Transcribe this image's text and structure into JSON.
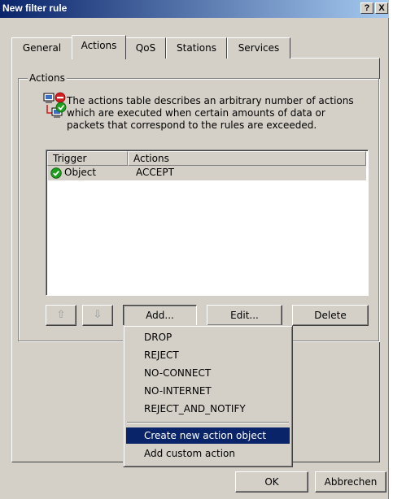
{
  "window": {
    "title": "New filter rule",
    "help_button": "?",
    "close_button": "X"
  },
  "tabs": [
    {
      "label": "General"
    },
    {
      "label": "Actions"
    },
    {
      "label": "QoS"
    },
    {
      "label": "Stations"
    },
    {
      "label": "Services"
    }
  ],
  "active_tab": "Actions",
  "actions_group": {
    "label": "Actions",
    "description": "The actions table describes an arbitrary number of actions which are executed when certain amounts of data or packets that correspond to the rules are exceeded.",
    "icon": "network-rule-icon"
  },
  "table": {
    "columns": [
      "Trigger",
      "Actions"
    ],
    "rows": [
      {
        "trigger": "Object",
        "action": "ACCEPT",
        "status_icon": "green-check-icon"
      }
    ]
  },
  "buttons": {
    "move_up": "⇧",
    "move_down": "⇩",
    "add": "Add...",
    "edit": "Edit...",
    "delete": "Delete",
    "ok": "OK",
    "cancel": "Abbrechen"
  },
  "add_menu": {
    "items": [
      {
        "label": "DROP"
      },
      {
        "label": "REJECT"
      },
      {
        "label": "NO-CONNECT"
      },
      {
        "label": "NO-INTERNET"
      },
      {
        "label": "REJECT_AND_NOTIFY"
      },
      {
        "label": "Create new action object"
      },
      {
        "label": "Add custom action"
      }
    ],
    "highlighted": "Create new action object"
  },
  "colors": {
    "titlebar_start": "#0a246a",
    "titlebar_end": "#a6caf0",
    "face": "#d4d0c8",
    "highlight": "#0a246a",
    "check_green": "#1e9e1e"
  }
}
